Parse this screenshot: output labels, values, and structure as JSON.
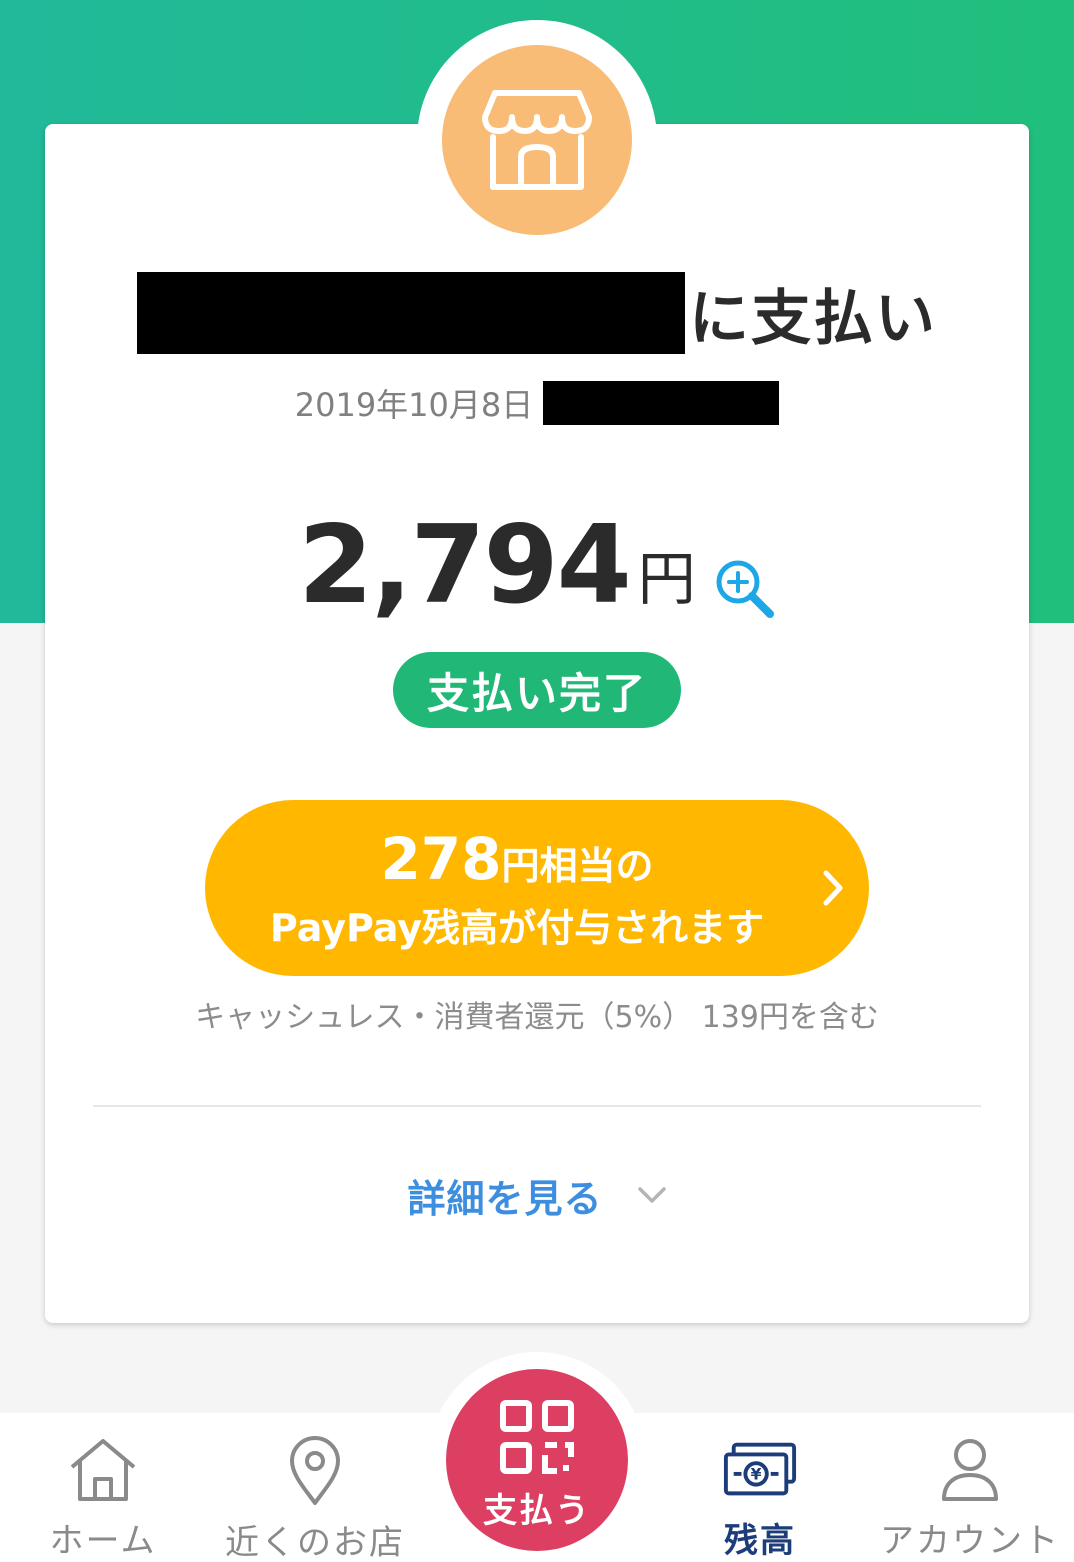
{
  "header": {
    "merchant_icon": "shop-icon",
    "title_suffix": "に支払い",
    "date": "2019年10月8日"
  },
  "payment": {
    "amount": "2,794",
    "currency": "円",
    "zoom_icon": "zoom-in-icon",
    "status": "支払い完了"
  },
  "bonus": {
    "amount": "278",
    "line1_rest": "円相当の",
    "line2": "PayPay残高が付与されます",
    "note": "キャッシュレス・消費者還元（5%） 139円を含む"
  },
  "details": {
    "label": "詳細を見る"
  },
  "bottom_nav": {
    "items": [
      {
        "label": "ホーム",
        "icon": "home-icon"
      },
      {
        "label": "近くのお店",
        "icon": "location-pin-icon"
      },
      {
        "label": "支払う",
        "icon": "qr-code-icon"
      },
      {
        "label": "残高",
        "icon": "wallet-yen-icon"
      },
      {
        "label": "アカウント",
        "icon": "person-icon"
      }
    ],
    "active_index": 3
  },
  "colors": {
    "header_teal": "#21b99a",
    "header_green": "#21bf7c",
    "shop_orange": "#f9bc77",
    "status_green": "#21b877",
    "bonus_yellow": "#ffb700",
    "link_blue": "#3e8ee0",
    "pay_red": "#dc3f62",
    "nav_active": "#1c3d7a"
  }
}
